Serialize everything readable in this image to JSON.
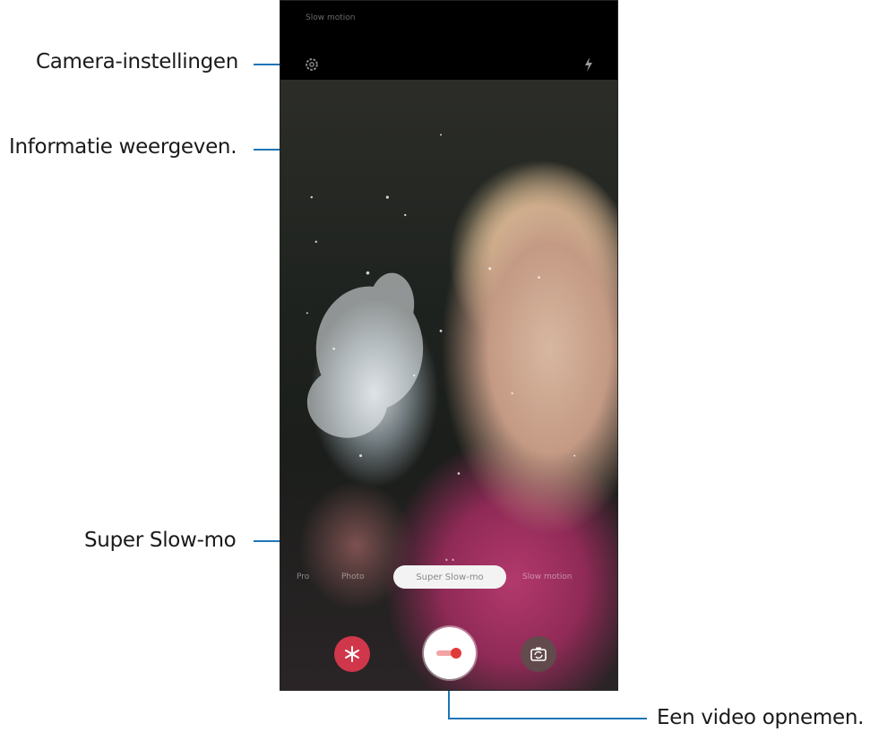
{
  "callouts": {
    "camera_settings": "Camera-instellingen",
    "info": "Informatie weergeven.",
    "super_slowmo": "Super Slow-mo",
    "record": "Een video opnemen."
  },
  "camera": {
    "mode_title": "Slow motion",
    "active_mode": "Super Slow-mo",
    "modes_left": [
      "Pro",
      "Photo"
    ],
    "modes_right": [
      "Slow motion"
    ],
    "icons": {
      "settings": "gear-icon",
      "flash": "flash-icon",
      "effect": "snowflake-effect-icon",
      "record": "record-icon",
      "switch": "switch-camera-icon"
    }
  },
  "colors": {
    "callout_line": "#1d75b7",
    "effect_button": "#d0374a",
    "record_dot": "#e23a3a"
  }
}
